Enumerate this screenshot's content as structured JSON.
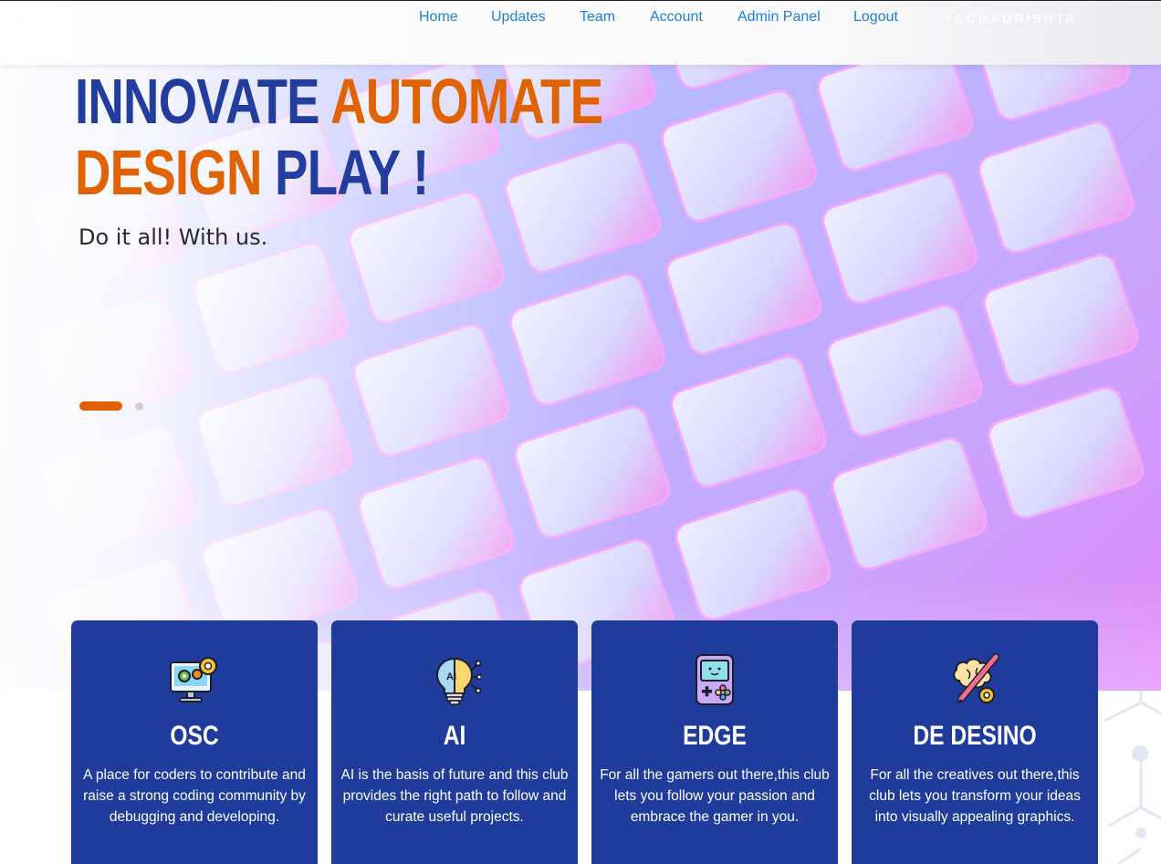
{
  "nav": {
    "links": [
      "Home",
      "Updates",
      "Team",
      "Account",
      "Admin Panel",
      "Logout"
    ],
    "brand": "TECHADRISHTA"
  },
  "hero": {
    "headline_line1_word1": "INNOVATE",
    "headline_line1_word2": "AUTOMATE",
    "headline_line2_word1": "DESIGN",
    "headline_line2_word2": "PLAY !",
    "subtitle": "Do it all! With us.",
    "slides_total": 2,
    "slide_active": 1
  },
  "cards": [
    {
      "title": "OSC",
      "icon": "monitor-gears-icon",
      "description": "A place for coders to contribute and raise a strong coding community by debugging and developing."
    },
    {
      "title": "AI",
      "icon": "ai-bulb-icon",
      "description": "AI is the basis of future and this club provides the right path to follow and curate useful projects."
    },
    {
      "title": "EDGE",
      "icon": "gameboy-icon",
      "description": "For all the gamers out there,this club lets you follow your passion and embrace the gamer in you."
    },
    {
      "title": "DE DESINO",
      "icon": "creative-brain-icon",
      "description": "For all the creatives out there,this club lets you transform your ideas into visually appealing graphics."
    }
  ],
  "colors": {
    "primary_blue": "#233d9f",
    "accent_orange": "#e06200",
    "card_blue": "#1f3c9c",
    "nav_link": "#1d7fd6"
  }
}
